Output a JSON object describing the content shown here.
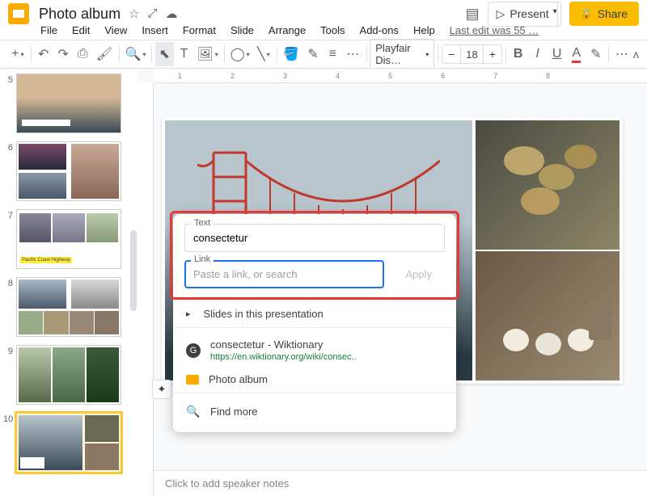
{
  "header": {
    "title": "Photo album",
    "present_label": "Present",
    "share_label": "Share",
    "last_edit": "Last edit was 55 …"
  },
  "menu": {
    "file": "File",
    "edit": "Edit",
    "view": "View",
    "insert": "Insert",
    "format": "Format",
    "slide": "Slide",
    "arrange": "Arrange",
    "tools": "Tools",
    "addons": "Add-ons",
    "help": "Help"
  },
  "toolbar": {
    "font": "Playfair Dis…",
    "font_size": "18",
    "minus": "−",
    "plus": "+"
  },
  "filmstrip": {
    "slides": [
      {
        "num": "5"
      },
      {
        "num": "6"
      },
      {
        "num": "7"
      },
      {
        "num": "8"
      },
      {
        "num": "9"
      },
      {
        "num": "10"
      }
    ],
    "caption7": "Pacific Coast Highway"
  },
  "dialog": {
    "text_label": "Text",
    "text_value": "consectetur",
    "link_label": "Link",
    "link_placeholder": "Paste a link, or search",
    "apply": "Apply",
    "slides_in": "Slides in this presentation",
    "wikt_title": "consectetur - Wiktionary",
    "wikt_url": "https://en.wiktionary.org/wiki/consec..",
    "photo_album": "Photo album",
    "find_more": "Find more"
  },
  "speaker_notes": "Click to add speaker notes"
}
